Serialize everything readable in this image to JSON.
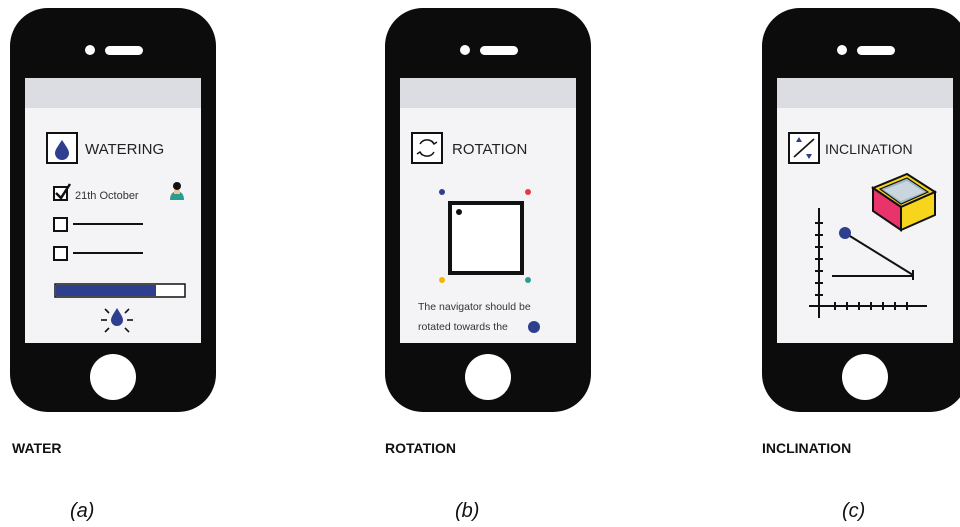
{
  "panels": [
    {
      "screen_title": "WATERING",
      "date_text": "21th October",
      "caption": "WATER",
      "sublabel": "(a)",
      "progress": 0.78
    },
    {
      "screen_title": "ROTATION",
      "instruction_line1": "The navigator should be",
      "instruction_line2": "rotated towards the",
      "caption": "ROTATION",
      "sublabel": "(b)"
    },
    {
      "screen_title": "INCLINATION",
      "caption": "INCLINATION",
      "sublabel": "(c)"
    }
  ],
  "colors": {
    "accent_blue": "#2f3f8f",
    "teal": "#2a9d8f",
    "red": "#e63946",
    "yellow": "#f4b400",
    "magenta": "#e8336b"
  },
  "icons": [
    "water-drop-icon",
    "rotation-icon",
    "inclination-icon",
    "gardener-icon",
    "sun-drop-icon",
    "planter-box-icon"
  ]
}
